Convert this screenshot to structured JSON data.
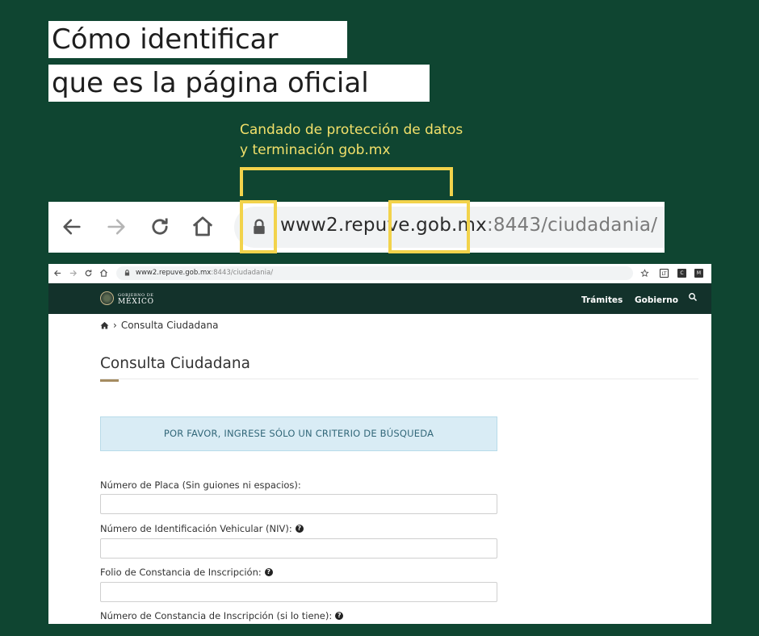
{
  "title_lines": [
    "Cómo identificar",
    "que es la página oficial"
  ],
  "callout": "Candado de protección de datos\ny terminación gob.mx",
  "zoom_bar": {
    "url_highlight": "www2.repuve.gob.mx",
    "url_rest": ":8443/ciudadania/",
    "icons": [
      "back-arrow-icon",
      "forward-arrow-icon",
      "reload-icon",
      "home-icon",
      "lock-icon"
    ]
  },
  "small_browser": {
    "url_highlight": "www2.repuve.gob.mx",
    "url_rest": ":8443/ciudadania/",
    "extensions": [
      "LT",
      "C",
      "M"
    ]
  },
  "gov_header": {
    "logo_top": "GOBIERNO DE",
    "logo_main": "MÉXICO",
    "menu": [
      "Trámites",
      "Gobierno"
    ]
  },
  "breadcrumb": "Consulta Ciudadana",
  "page_title": "Consulta Ciudadana",
  "alert": "POR FAVOR, INGRESE SÓLO UN CRITERIO DE BÚSQUEDA",
  "fields": [
    {
      "label": "Número de Placa (Sin guiones ni espacios):",
      "help": false,
      "value": ""
    },
    {
      "label": "Número de Identificación Vehicular (NIV):",
      "help": true,
      "value": ""
    },
    {
      "label": "Folio de Constancia de Inscripción:",
      "help": true,
      "value": ""
    },
    {
      "label": "Número de Constancia de Inscripción (si lo tiene):",
      "help": true,
      "value": ""
    }
  ],
  "colors": {
    "background": "#0f4531",
    "highlight": "#f2d34b",
    "gov_bar": "#13322b",
    "accent": "#a58c61"
  }
}
